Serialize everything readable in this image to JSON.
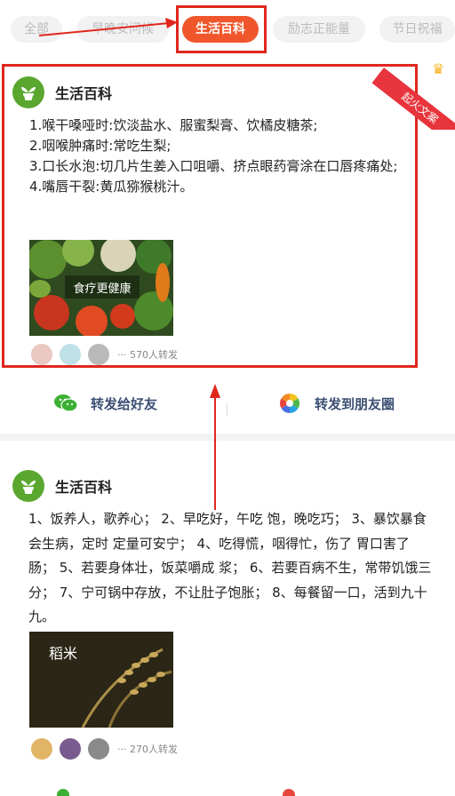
{
  "tabs": [
    {
      "label": "全部",
      "active": false
    },
    {
      "label": "早晚安问候",
      "active": false
    },
    {
      "label": "生活百科",
      "active": true
    },
    {
      "label": "励志正能量",
      "active": false
    },
    {
      "label": "节日祝福",
      "active": false
    }
  ],
  "ribbon_label": "起火文案",
  "cards": [
    {
      "title": "生活百科",
      "lines": [
        "1.喉干嗓哑时:饮淡盐水、服蜜梨膏、饮橘皮糖茶;",
        "2.咽喉肿痛时:常吃生梨;",
        "3.口长水泡:切几片生姜入口咀嚼、挤点眼药膏涂在口唇疼痛处;",
        "4.嘴唇干裂:黄瓜猕猴桃汁。"
      ],
      "image_caption": "食疗更健康",
      "share_count": "··· 570人转发"
    },
    {
      "title": "生活百科",
      "text": "1、饭养人，歌养心； 2、早吃好，午吃 饱，晚吃巧； 3、暴饮暴食会生病，定时 定量可安宁； 4、吃得慌，咽得忙，伤了 胃口害了肠； 5、若要身体壮，饭菜嚼成 浆； 6、若要百病不生，常带饥饿三分； 7、宁可锅中存放，不让肚子饱胀； 8、每餐留一口，活到九十九。",
      "image_caption": "稻米",
      "share_count": "··· 270人转发"
    }
  ],
  "forward": {
    "friend_label": "转发给好友",
    "moments_label": "转发到朋友圈"
  },
  "colors": {
    "accent": "#f0562c",
    "highlight_red": "#e0271d",
    "brand_green": "#5aa72f",
    "wechat_green": "#3cb034"
  }
}
